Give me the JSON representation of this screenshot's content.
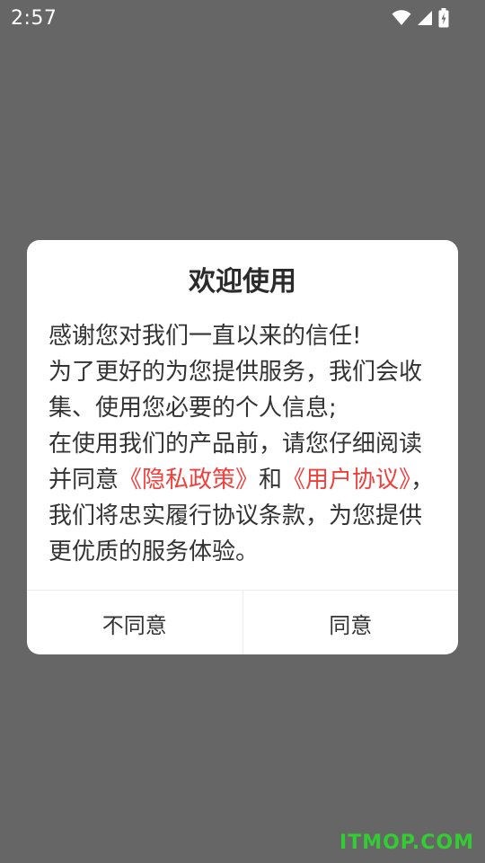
{
  "status_bar": {
    "time": "2:57",
    "icons": [
      "wifi-icon",
      "cellular-signal-icon",
      "battery-charging-icon"
    ]
  },
  "dialog": {
    "title": "欢迎使用",
    "body": {
      "line1": "感谢您对我们一直以来的信任!",
      "line2": "为了更好的为您提供服务，我们会收集、使用您必要的个人信息;",
      "line3_before": "在使用我们的产品前，请您仔细阅读并同意",
      "privacy_link": "《隐私政策》",
      "connector": "和",
      "agreement_link": "《用户协议》",
      "line3_after": "，我们将忠实履行协议条款，为您提供更优质的服务体验。"
    },
    "buttons": {
      "disagree": "不同意",
      "agree": "同意"
    }
  },
  "watermark": "ITMOP.COM",
  "colors": {
    "overlay": "#666666",
    "link": "#f0403c",
    "watermark": "#33cc33"
  }
}
